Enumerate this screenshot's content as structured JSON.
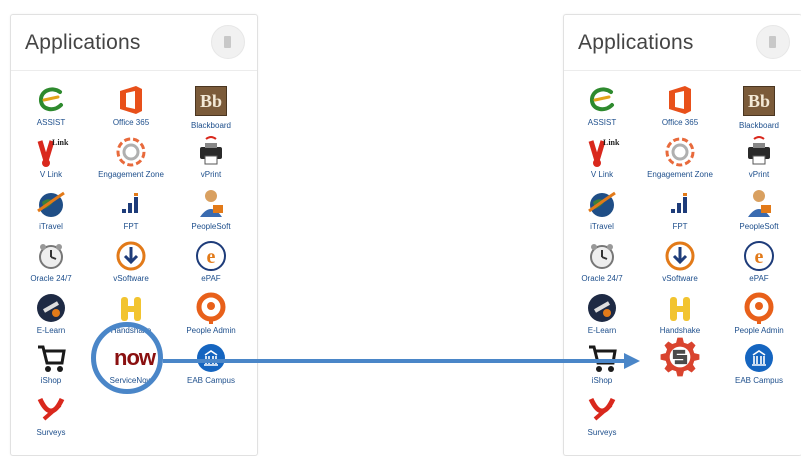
{
  "left_panel": {
    "title": "Applications",
    "apps": {
      "assist": "ASSIST",
      "office365": "Office 365",
      "blackboard": "Blackboard",
      "vlink": "V Link",
      "engagement": "Engagement Zone",
      "vprint": "vPrint",
      "itravel": "iTravel",
      "fpt": "FPT",
      "peoplesoft": "PeopleSoft",
      "oracle": "Oracle 24/7",
      "vsoftware": "vSoftware",
      "epaf": "ePAF",
      "elearn": "E-Learn",
      "handshake": "Handshake",
      "peopleadmin": "People Admin",
      "ishop": "iShop",
      "servicenow": "ServiceNow",
      "eab": "EAB Campus",
      "surveys": "Surveys"
    },
    "icon_text": {
      "blackboard": "Bb",
      "servicenow": "now",
      "vlink": "Link"
    }
  },
  "right_panel": {
    "title": "Applications",
    "apps": {
      "assist": "ASSIST",
      "office365": "Office 365",
      "blackboard": "Blackboard",
      "vlink": "V Link",
      "engagement": "Engagement Zone",
      "vprint": "vPrint",
      "itravel": "iTravel",
      "fpt": "FPT",
      "peoplesoft": "PeopleSoft",
      "oracle": "Oracle 24/7",
      "vsoftware": "vSoftware",
      "epaf": "ePAF",
      "elearn": "E-Learn",
      "handshake": "Handshake",
      "peopleadmin": "People Admin",
      "ishop": "iShop",
      "eab": "EAB Campus",
      "surveys": "Surveys"
    },
    "icon_text": {
      "blackboard": "Bb",
      "vlink": "Link"
    }
  },
  "colors": {
    "label": "#1e4f8c",
    "highlight": "#4a86c8",
    "arrow": "#4a86c8",
    "servicenow_red": "#8a1010",
    "gear_red": "#d9432e"
  }
}
